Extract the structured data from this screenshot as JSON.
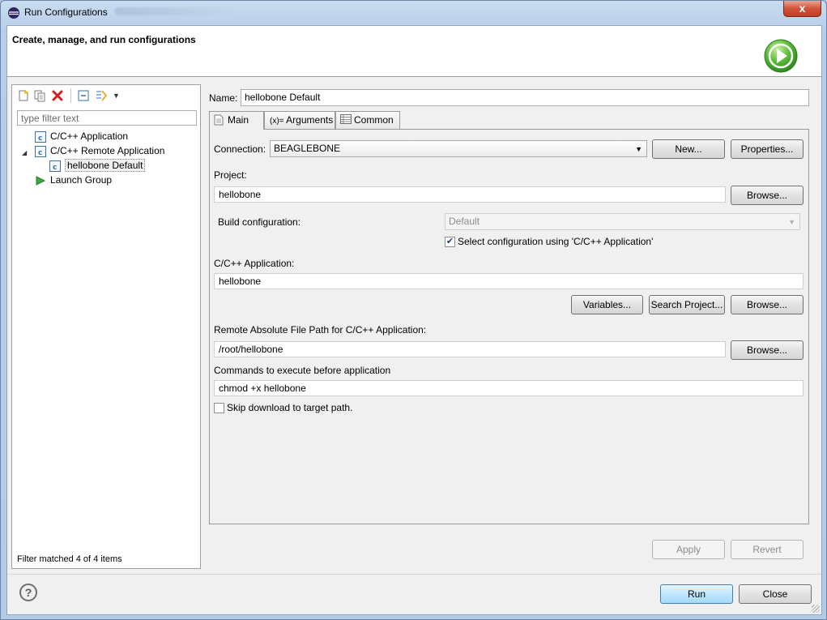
{
  "window": {
    "title": "Run Configurations",
    "close_glyph": "x"
  },
  "header": {
    "title": "Create, manage, and run configurations",
    "icon": "run-badge-icon"
  },
  "left": {
    "filter_placeholder": "type filter text",
    "tree": [
      {
        "label": "C/C++ Application",
        "icon": "c-file-icon"
      },
      {
        "label": "C/C++ Remote Application",
        "icon": "c-file-icon",
        "expanded": true
      },
      {
        "label": "hellobone Default",
        "icon": "c-file-icon",
        "selected": true
      },
      {
        "label": "Launch Group",
        "icon": "launch-arrow-icon"
      }
    ],
    "status": "Filter matched 4 of 4 items"
  },
  "config": {
    "name_label": "Name:",
    "name_value": "hellobone Default",
    "tabs": [
      {
        "label": "Main",
        "active": true
      },
      {
        "label": "Arguments",
        "prefix": "(x)="
      },
      {
        "label": "Common"
      }
    ],
    "main": {
      "connection_label": "Connection:",
      "connection_value": "BEAGLEBONE",
      "new_button": "New...",
      "properties_button": "Properties...",
      "project_label": "Project:",
      "project_value": "hellobone",
      "browse_button": "Browse...",
      "build_config_label": "Build configuration:",
      "build_config_value": "Default",
      "select_config_label": "Select configuration using 'C/C++ Application'",
      "select_config_checked": true,
      "app_label": "C/C++ Application:",
      "app_value": "hellobone",
      "variables_button": "Variables...",
      "search_project_button": "Search Project...",
      "remote_path_label": "Remote Absolute File Path for C/C++ Application:",
      "remote_path_value": "/root/hellobone",
      "commands_label": "Commands to execute before application",
      "commands_value": "chmod +x hellobone",
      "skip_download_label": "Skip download to target path.",
      "skip_download_checked": false
    },
    "apply_button": "Apply",
    "revert_button": "Revert"
  },
  "footer": {
    "help_glyph": "?",
    "run_button": "Run",
    "close_button": "Close"
  },
  "colors": {
    "accent": "#3c7fb1",
    "error_red": "#d0553b",
    "run_green": "#2e9a2e"
  }
}
